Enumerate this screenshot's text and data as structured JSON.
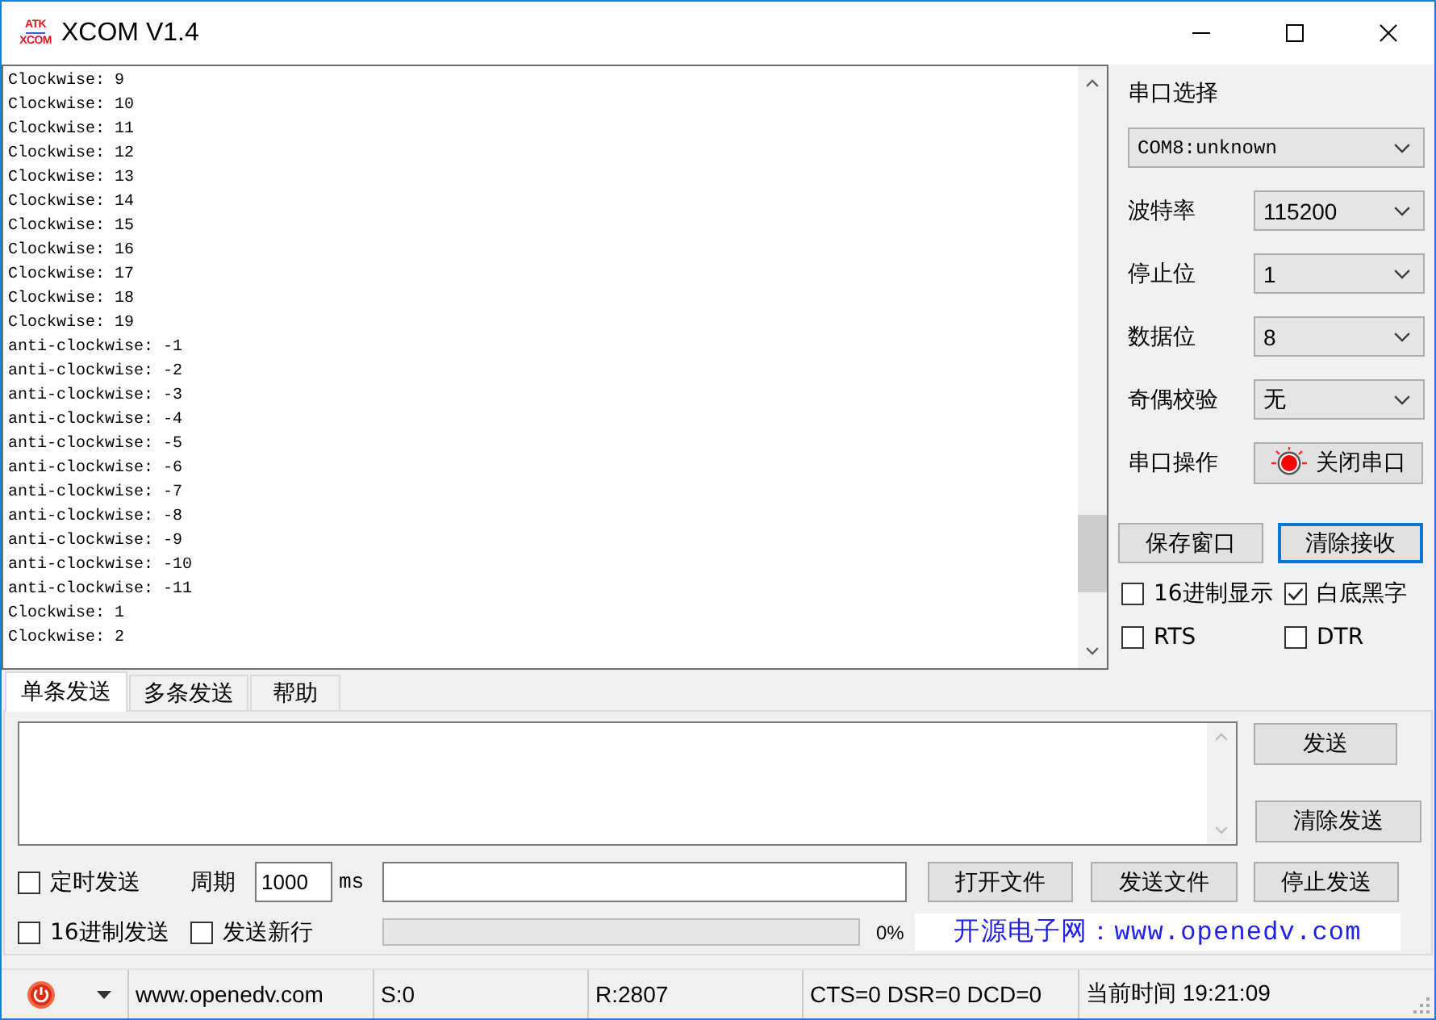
{
  "window": {
    "title": "XCOM V1.4",
    "logo": [
      "ATK",
      "XCOM"
    ]
  },
  "receive": {
    "lines": [
      "Clockwise: 9",
      "Clockwise: 10",
      "Clockwise: 11",
      "Clockwise: 12",
      "Clockwise: 13",
      "Clockwise: 14",
      "Clockwise: 15",
      "Clockwise: 16",
      "Clockwise: 17",
      "Clockwise: 18",
      "Clockwise: 19",
      "anti-clockwise: -1",
      "anti-clockwise: -2",
      "anti-clockwise: -3",
      "anti-clockwise: -4",
      "anti-clockwise: -5",
      "anti-clockwise: -6",
      "anti-clockwise: -7",
      "anti-clockwise: -8",
      "anti-clockwise: -9",
      "anti-clockwise: -10",
      "anti-clockwise: -11",
      "Clockwise: 1",
      "Clockwise: 2"
    ]
  },
  "serial": {
    "port_label": "串口选择",
    "port": "COM8:unknown",
    "settings": [
      {
        "label": "波特率",
        "value": "115200"
      },
      {
        "label": "停止位",
        "value": "1"
      },
      {
        "label": "数据位",
        "value": "8"
      },
      {
        "label": "奇偶校验",
        "value": "无"
      }
    ],
    "operation": {
      "label": "串口操作",
      "button": "关闭串口"
    }
  },
  "receive_buttons": [
    {
      "label": "保存窗口",
      "focused": false
    },
    {
      "label": "清除接收",
      "focused": true
    }
  ],
  "options": [
    {
      "label": "16进制显示",
      "checked": false
    },
    {
      "label": "白底黑字",
      "checked": true
    },
    {
      "label": "RTS",
      "checked": false
    },
    {
      "label": "DTR",
      "checked": false
    }
  ],
  "send_tabs": [
    {
      "label": "单条发送",
      "selected": true
    },
    {
      "label": "多条发送",
      "selected": false
    },
    {
      "label": "帮助",
      "selected": false
    }
  ],
  "send": {
    "send_button": "发送",
    "clear_button": "清除发送",
    "timed": {
      "label": "定时发送",
      "checked": false
    },
    "period": {
      "label": "周期",
      "value": "1000",
      "unit": "ms"
    },
    "file_buttons": [
      "打开文件",
      "发送文件",
      "停止发送"
    ],
    "hex": {
      "label": "16进制发送",
      "checked": false
    },
    "newline": {
      "label": "发送新行",
      "checked": false
    },
    "progress": {
      "reading": "0%"
    },
    "banner": "开源电子网：www.openedv.com"
  },
  "status_bar": {
    "sections": [
      "www.openedv.com",
      "S:0",
      "R:2807",
      "CTS=0 DSR=0 DCD=0",
      "当前时间 19:21:09"
    ]
  }
}
